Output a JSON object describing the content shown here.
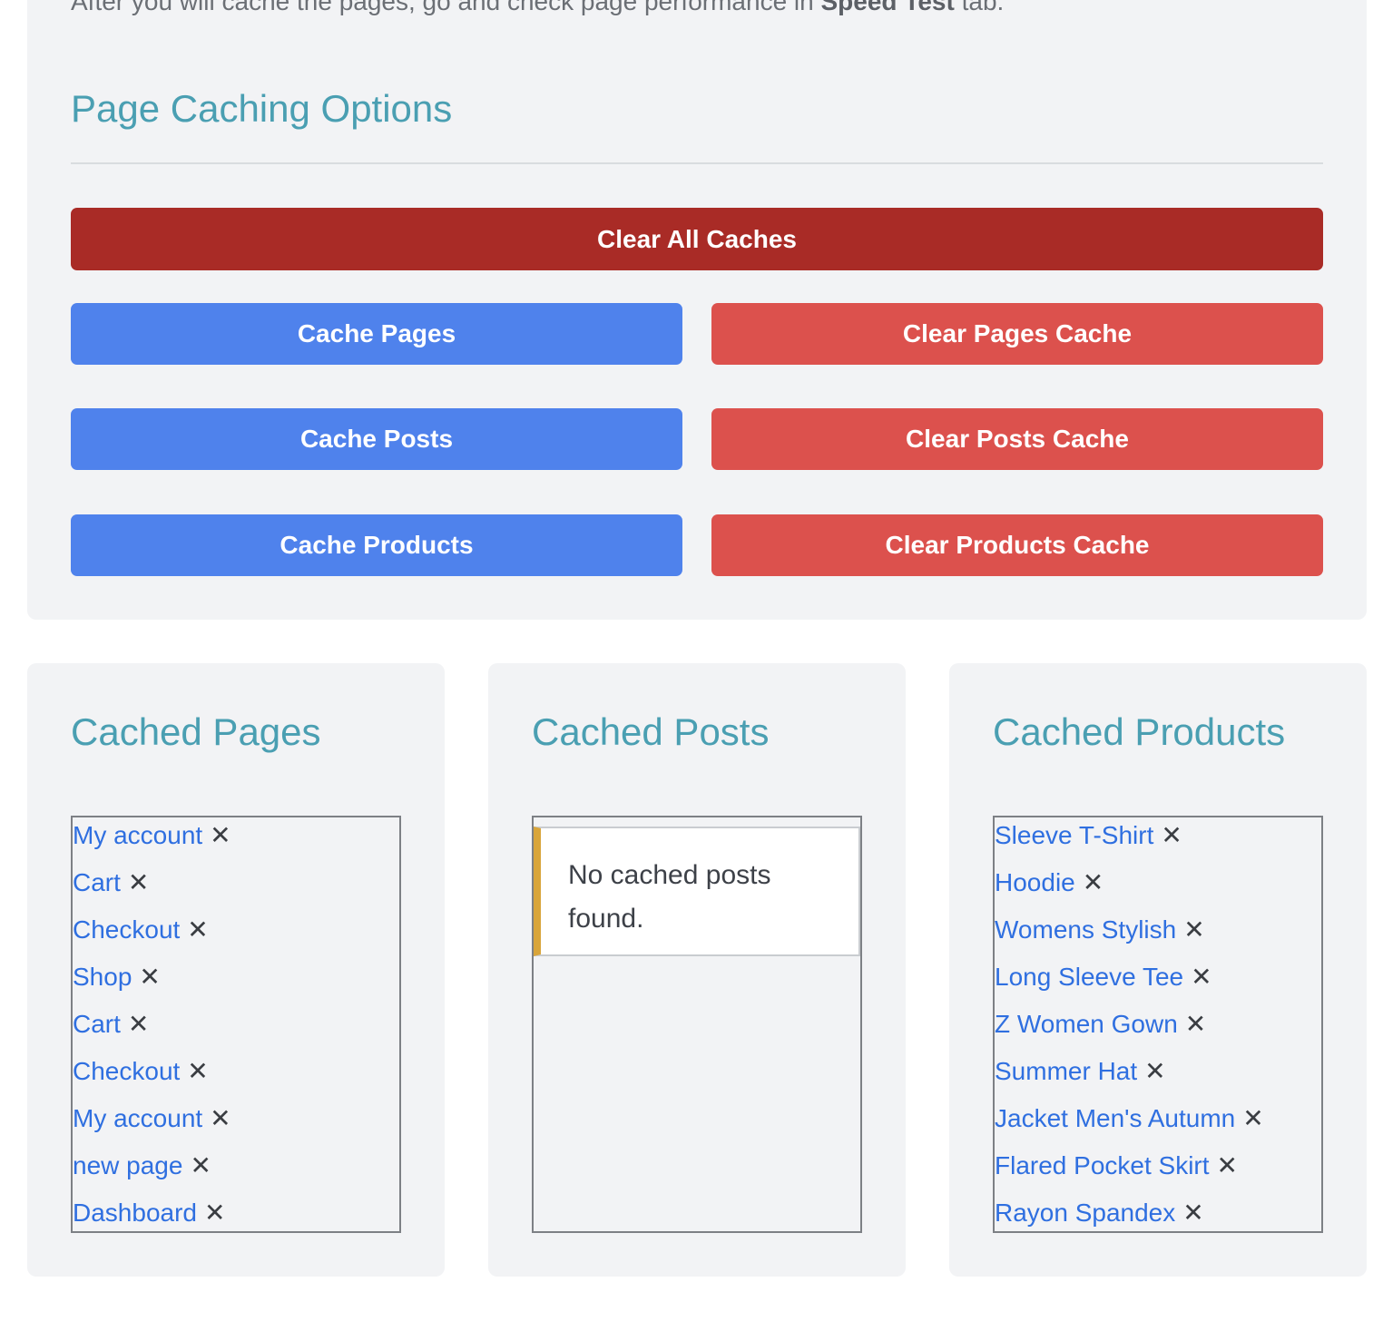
{
  "intro": {
    "text_before": "After you will cache the pages, go and check page performance in ",
    "bold": "Speed Test",
    "text_after": " tab."
  },
  "options": {
    "title": "Page Caching Options",
    "clear_all_label": "Clear All Caches",
    "cache_pages_label": "Cache Pages",
    "clear_pages_label": "Clear Pages Cache",
    "cache_posts_label": "Cache Posts",
    "clear_posts_label": "Clear Posts Cache",
    "cache_products_label": "Cache Products",
    "clear_products_label": "Clear Products Cache"
  },
  "colors": {
    "title": "#4a9fb2",
    "clear_all": "#a92b26",
    "cache_button": "#4f82ec",
    "clear_button": "#dc514d",
    "link": "#2f6fe0",
    "notice_accent": "#d9a53a"
  },
  "cached_pages": {
    "title": "Cached Pages",
    "items": [
      "My account",
      "Cart",
      "Checkout",
      "Shop",
      "Cart",
      "Checkout",
      "My account",
      "new page",
      "Dashboard"
    ]
  },
  "cached_posts": {
    "title": "Cached Posts",
    "empty_notice": "No cached posts found."
  },
  "cached_products": {
    "title": "Cached Products",
    "items": [
      "Sleeve T-Shirt",
      "Hoodie",
      "Womens Stylish",
      "Long Sleeve Tee",
      "Z Women Gown",
      "Summer Hat",
      "Jacket Men's Autumn",
      "Flared Pocket Skirt",
      "Rayon Spandex"
    ]
  },
  "remove_glyph": "✕",
  "icons": {
    "remove": "close-icon"
  }
}
